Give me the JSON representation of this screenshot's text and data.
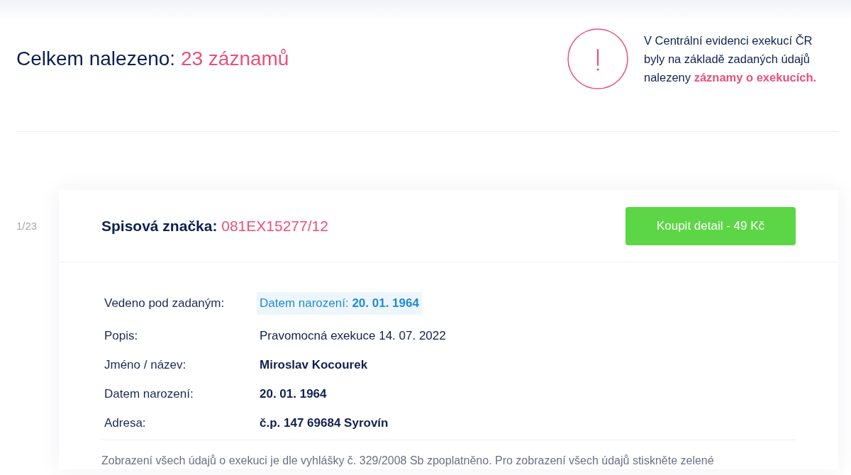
{
  "summary": {
    "label": "Celkem nalezeno:",
    "count": "23 záznamů"
  },
  "alert": {
    "text": "V Centrální evidenci exekucí ČR byly na základě zadaných údajů nalezeny",
    "highlight": "záznamy o exekucích."
  },
  "record": {
    "index": "1/23",
    "case_label": "Spisová značka:",
    "case_number": "081EX15277/12",
    "buy_button": "Koupit detail - 49 Kč",
    "fields": [
      {
        "label": "Vedeno pod zadaným:",
        "value": "Datem narození: **20. 01. 1964**",
        "kind": "match"
      },
      {
        "label": "Popis:",
        "value": "Pravomocná exekuce 14. 07. 2022",
        "kind": "plain"
      },
      {
        "label": "Jméno / název:",
        "value": "Miroslav Kocourek",
        "kind": "strong"
      },
      {
        "label": "Datem narození:",
        "value": "20. 01. 1964",
        "kind": "strong"
      },
      {
        "label": "Adresa:",
        "value": "č.p. 147 69684 Syrovín",
        "kind": "strong"
      }
    ],
    "note": "Zobrazení všech údajů o exekuci je dle vyhlášky č. 329/2008 Sb zpoplatněno. Pro zobrazení všech údajů stiskněte zelené"
  }
}
